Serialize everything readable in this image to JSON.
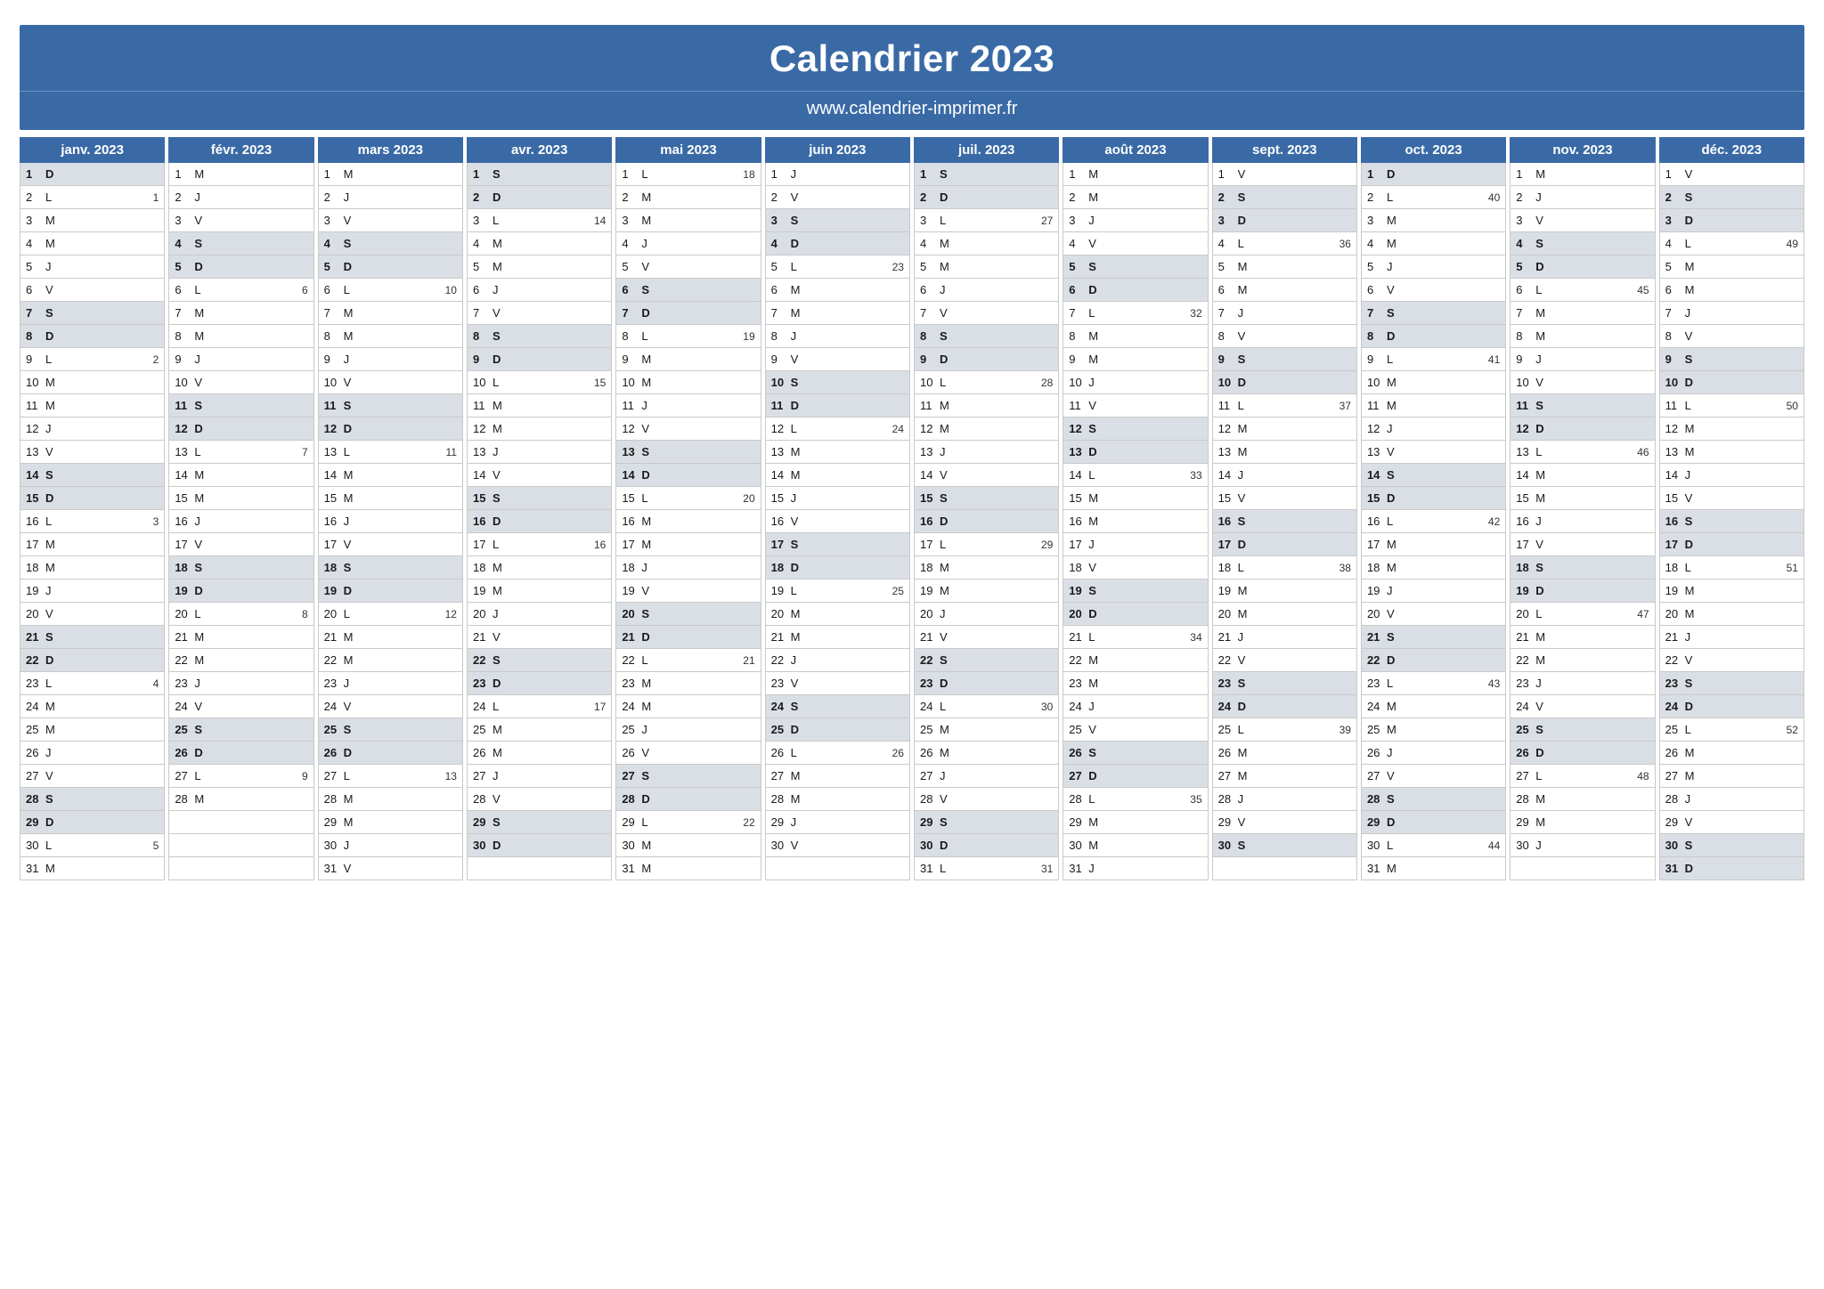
{
  "title": "Calendrier 2023",
  "url": "www.calendrier-imprimer.fr",
  "months": [
    {
      "name": "janv. 2023",
      "startDow": 6,
      "len": 31,
      "weeks": {
        "2": 1,
        "9": 2,
        "16": 3,
        "23": 4,
        "30": 5
      }
    },
    {
      "name": "févr. 2023",
      "startDow": 2,
      "len": 28,
      "weeks": {
        "6": 6,
        "13": 7,
        "20": 8,
        "27": 9
      }
    },
    {
      "name": "mars 2023",
      "startDow": 2,
      "len": 31,
      "weeks": {
        "6": 10,
        "13": 11,
        "20": 12,
        "27": 13
      }
    },
    {
      "name": "avr. 2023",
      "startDow": 5,
      "len": 30,
      "weeks": {
        "3": 14,
        "10": 15,
        "17": 16,
        "24": 17
      }
    },
    {
      "name": "mai 2023",
      "startDow": 0,
      "len": 31,
      "weeks": {
        "1": 18,
        "8": 19,
        "15": 20,
        "22": 21,
        "29": 22
      }
    },
    {
      "name": "juin 2023",
      "startDow": 3,
      "len": 30,
      "weeks": {
        "5": 23,
        "12": 24,
        "19": 25,
        "26": 26
      }
    },
    {
      "name": "juil. 2023",
      "startDow": 5,
      "len": 31,
      "weeks": {
        "3": 27,
        "10": 28,
        "17": 29,
        "24": 30,
        "31": 31
      }
    },
    {
      "name": "août 2023",
      "startDow": 1,
      "len": 31,
      "weeks": {
        "7": 32,
        "14": 33,
        "21": 34,
        "28": 35
      }
    },
    {
      "name": "sept. 2023",
      "startDow": 4,
      "len": 30,
      "weeks": {
        "4": 36,
        "11": 37,
        "18": 38,
        "25": 39
      }
    },
    {
      "name": "oct. 2023",
      "startDow": 6,
      "len": 31,
      "weeks": {
        "2": 40,
        "9": 41,
        "16": 42,
        "23": 43,
        "30": 44
      }
    },
    {
      "name": "nov. 2023",
      "startDow": 2,
      "len": 30,
      "weeks": {
        "6": 45,
        "13": 46,
        "20": 47,
        "27": 48
      }
    },
    {
      "name": "déc. 2023",
      "startDow": 4,
      "len": 31,
      "weeks": {
        "4": 49,
        "11": 50,
        "18": 51,
        "25": 52
      }
    }
  ],
  "dowLetters": [
    "L",
    "M",
    "M",
    "J",
    "V",
    "S",
    "D"
  ]
}
